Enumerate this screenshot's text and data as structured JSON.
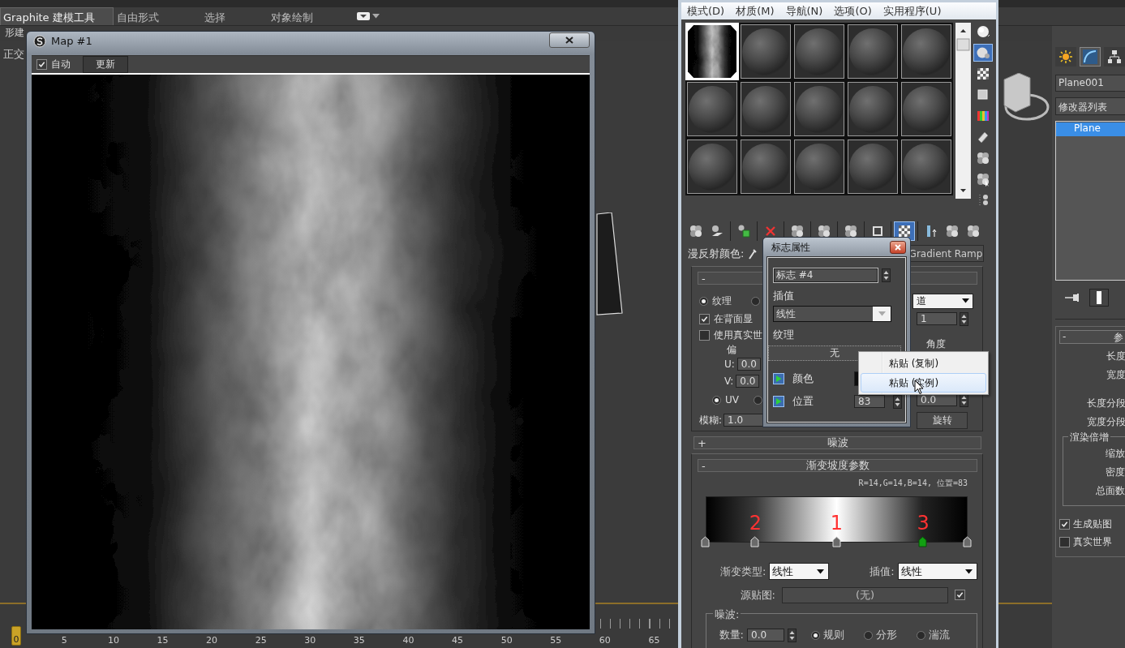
{
  "app": {
    "ribbon_tabs": [
      {
        "label": "Graphite 建模工具",
        "selected": true
      },
      {
        "label": "自由形式",
        "selected": false
      },
      {
        "label": "选择",
        "selected": false
      },
      {
        "label": "对象绘制",
        "selected": false
      }
    ],
    "ribbon_panel_label": "形建",
    "viewport_label": "正交",
    "timeline": {
      "frame": "0",
      "level": 0,
      "ticks": [
        "5",
        "10",
        "15",
        "20",
        "25",
        "30",
        "35",
        "40",
        "45",
        "50",
        "55",
        "60",
        "65"
      ]
    }
  },
  "map_window": {
    "title": "Map #1",
    "auto_update": {
      "label": "自动",
      "checked": true
    },
    "update_button": "更新"
  },
  "material_editor": {
    "menu": [
      "模式(D)",
      "材质(M)",
      "导航(N)",
      "选项(O)",
      "实用程序(U)"
    ],
    "sample_slots": [
      {
        "kind": "noise",
        "selected": true
      },
      {
        "kind": "sphere",
        "selected": false
      },
      {
        "kind": "sphere",
        "selected": false
      },
      {
        "kind": "sphere",
        "selected": false
      },
      {
        "kind": "sphere",
        "selected": false
      },
      {
        "kind": "sphere",
        "selected": false
      },
      {
        "kind": "sphere",
        "selected": false
      },
      {
        "kind": "sphere",
        "selected": false
      },
      {
        "kind": "sphere",
        "selected": false
      },
      {
        "kind": "sphere",
        "selected": false
      },
      {
        "kind": "sphere",
        "selected": false
      },
      {
        "kind": "sphere",
        "selected": false
      },
      {
        "kind": "sphere",
        "selected": false
      },
      {
        "kind": "sphere",
        "selected": false
      },
      {
        "kind": "sphere",
        "selected": false
      }
    ],
    "side_tools": [
      {
        "selected": false
      },
      {
        "selected": true
      },
      {
        "selected": false
      },
      {
        "selected": false
      },
      {
        "selected": false
      },
      {
        "selected": false
      },
      {
        "selected": false
      },
      {
        "selected": false
      },
      {
        "selected": false
      }
    ],
    "toolbar": [
      {
        "selected": false
      },
      {
        "selected": false
      },
      {
        "selected": false
      },
      {
        "selected": false
      },
      {
        "selected": false
      },
      {
        "selected": false
      },
      {
        "selected": false
      },
      {
        "selected": false
      },
      {
        "selected": true
      },
      {
        "selected": false
      },
      {
        "selected": false
      },
      {
        "selected": false
      }
    ],
    "diffuse_label": "漫反射颜色:",
    "map_type_button": "Gradient Ramp",
    "coordinates": {
      "toggle": "-",
      "texture_radio": {
        "label": "纹理",
        "selected": true
      },
      "second_radio": {
        "selected": false
      },
      "channel_dropdown": "道",
      "show_back": {
        "label": "在背面显",
        "checked": true
      },
      "real_world": {
        "label": "使用真实世",
        "checked": false
      },
      "offset_label": "偏",
      "angle_label": "角度",
      "u": {
        "label": "U:",
        "value": "0.0"
      },
      "v": {
        "label": "V:",
        "value": "0.0"
      },
      "channel_value": "1",
      "angle_value": "0.0",
      "uv_radio": {
        "label": "UV",
        "selected": true
      },
      "other_radio": {
        "selected": false
      },
      "blur": {
        "label": "模糊:",
        "value": "1.0"
      },
      "rotate_button": "旋转"
    },
    "noise_rollout": {
      "toggle": "+",
      "title": "噪波"
    },
    "ramp_rollout": {
      "toggle": "-",
      "title": "渐变坡度参数",
      "info": "R=14,G=14,B=14, 位置=83",
      "flags": [
        {
          "level": 0,
          "selected": false
        },
        {
          "level": 0.19,
          "selected": false,
          "annotation": "2"
        },
        {
          "level": 0.5,
          "selected": false,
          "annotation": "1"
        },
        {
          "level": 0.83,
          "selected": true,
          "annotation": "3"
        },
        {
          "level": 1,
          "selected": false
        }
      ],
      "ramp_type": {
        "label": "渐变类型:",
        "value": "线性"
      },
      "interpolation": {
        "label": "插值:",
        "value": "线性"
      },
      "source_map": {
        "label": "源贴图:",
        "value": "(无)",
        "checked": true
      },
      "noise_group": {
        "title": "噪波:",
        "amount": {
          "label": "数量:",
          "value": "0.0"
        },
        "types": [
          {
            "label": "规则",
            "selected": true
          },
          {
            "label": "分形",
            "selected": false
          },
          {
            "label": "湍流",
            "selected": false
          }
        ]
      }
    }
  },
  "flag_dialog": {
    "title": "标志属性",
    "flag_name": "标志 #4",
    "interp_label": "插值",
    "interp_value": "线性",
    "texture_label": "纹理",
    "texture_button": "无",
    "color": {
      "label": "颜色"
    },
    "position": {
      "label": "位置",
      "value": "83"
    }
  },
  "context_menu": {
    "items": [
      {
        "label": "粘贴 (复制)",
        "selected": false
      },
      {
        "label": "粘贴 (实例)",
        "selected": true
      }
    ]
  },
  "command_panel": {
    "tabs": [
      {
        "selected": false
      },
      {
        "selected": true
      },
      {
        "selected": false
      }
    ],
    "object_name": "Plane001",
    "modifier_list": "修改器列表",
    "stack": [
      {
        "label": "Plane",
        "selected": true
      }
    ],
    "rollout_toggle": "-",
    "rollout_title": "参",
    "params": [
      "长度",
      "宽度",
      "长度分段",
      "宽度分段"
    ],
    "render_group": {
      "title": "渲染倍增",
      "params": [
        "缩放",
        "密度",
        "总面数"
      ]
    },
    "options": [
      {
        "label": "生成贴图",
        "checked": true
      },
      {
        "label": "真实世界",
        "checked": false
      }
    ]
  }
}
